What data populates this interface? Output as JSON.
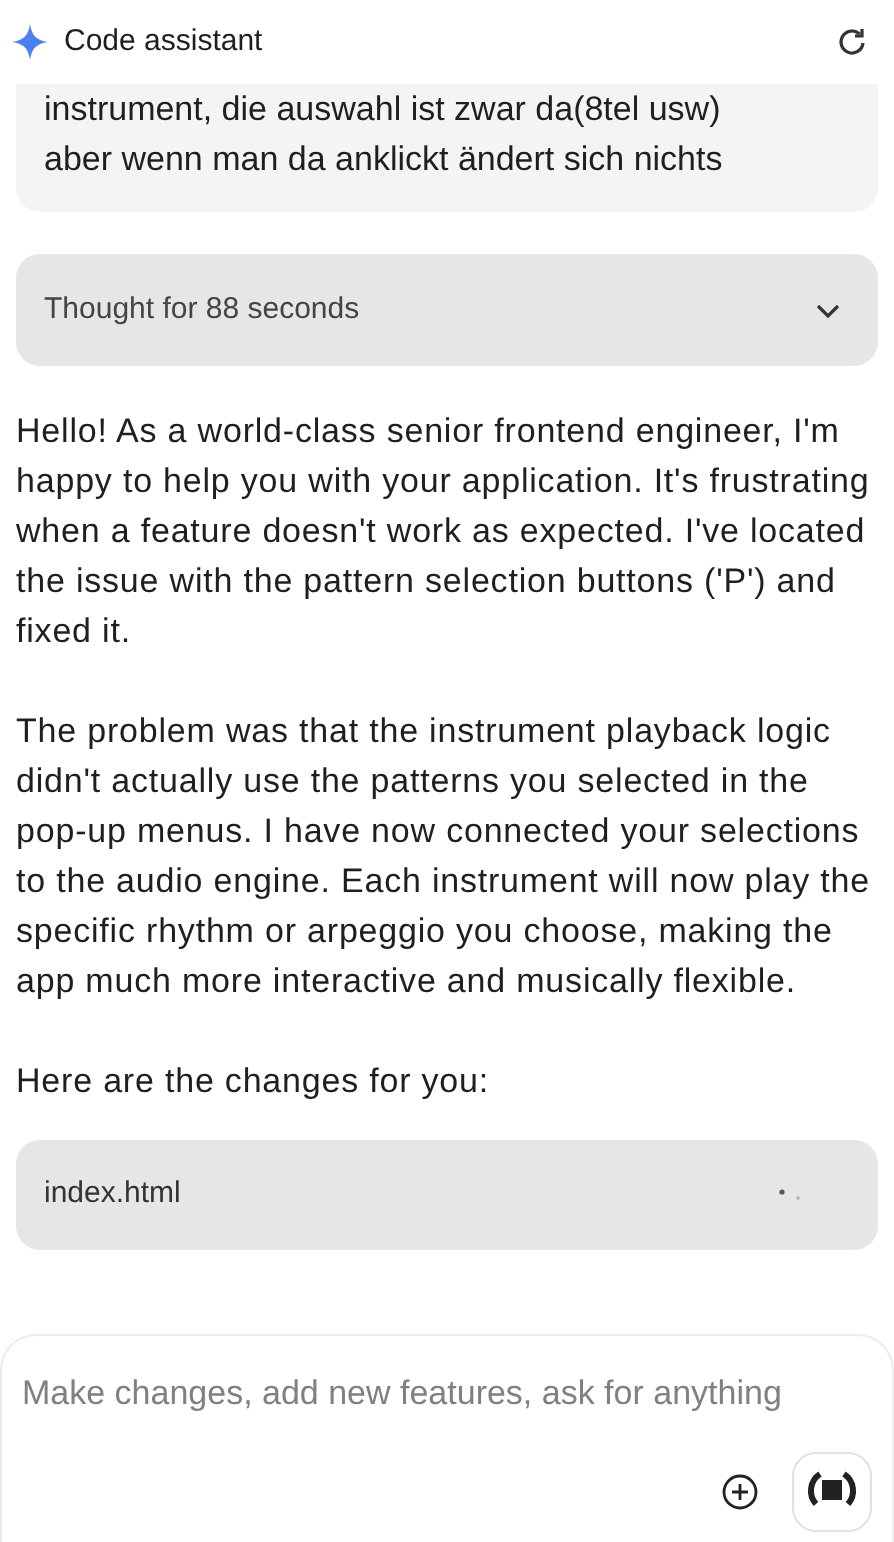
{
  "header": {
    "title": "Code assistant"
  },
  "user_message": {
    "lines": [
      "instrument, die auswahl ist zwar da(8tel usw)",
      "aber wenn man da anklickt ändert sich nichts"
    ]
  },
  "thought": {
    "label": "Thought for 88 seconds",
    "expanded": false
  },
  "response": {
    "paragraphs": [
      "Hello! As a world-class senior frontend engineer, I'm happy to help you with your application. It's frustrating when a feature doesn't work as expected. I've located the issue with the pattern selection buttons ('P') and fixed it.",
      "The problem was that the instrument playback logic didn't actually use the patterns you selected in the pop-up menus. I have now connected your selections to the audio engine. Each instrument will now play the specific rhythm or arpeggio you choose, making the app much more interactive and musically flexible.",
      "Here are the changes for you:"
    ]
  },
  "file_card": {
    "name": "index.html",
    "loading": true
  },
  "composer": {
    "placeholder": "Make changes, add new features, ask for anything"
  }
}
